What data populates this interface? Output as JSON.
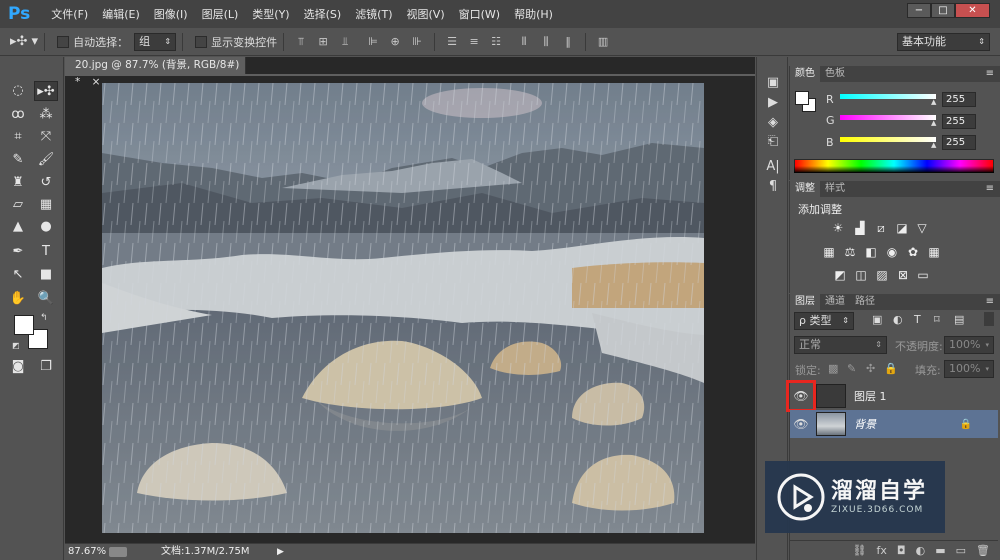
{
  "app": {
    "logo": "Ps"
  },
  "menu": [
    "文件(F)",
    "编辑(E)",
    "图像(I)",
    "图层(L)",
    "类型(Y)",
    "选择(S)",
    "滤镜(T)",
    "视图(V)",
    "窗口(W)",
    "帮助(H)"
  ],
  "window_controls": {
    "minimize": "−",
    "maximize": "□",
    "close": "✕"
  },
  "options": {
    "auto_select_label": "自动选择：",
    "auto_select_value": "组",
    "show_transform_label": "显示变换控件",
    "workspace": "基本功能"
  },
  "document": {
    "tab_title": "20.jpg @ 87.7% (背景, RGB/8#) *",
    "close_glyph": "×"
  },
  "status": {
    "zoom": "87.67%",
    "doc_size": "文档:1.37M/2.75M"
  },
  "color_panel": {
    "tabs": [
      "颜色",
      "色板"
    ],
    "channels": [
      {
        "label": "R",
        "value": "255"
      },
      {
        "label": "G",
        "value": "255"
      },
      {
        "label": "B",
        "value": "255"
      }
    ]
  },
  "adjust_panel": {
    "tabs": [
      "调整",
      "样式"
    ],
    "title": "添加调整"
  },
  "layers_panel": {
    "tabs": [
      "图层",
      "通道",
      "路径"
    ],
    "kind_filter": "ρ 类型",
    "blend_mode": "正常",
    "opacity_label": "不透明度:",
    "opacity_value": "100%",
    "lock_label": "锁定:",
    "fill_label": "填充:",
    "fill_value": "100%",
    "layers": [
      {
        "name": "图层 1",
        "visible": true,
        "selected": false,
        "locked": false
      },
      {
        "name": "背景",
        "visible": true,
        "selected": true,
        "locked": true
      }
    ]
  },
  "watermark": {
    "brand_cn": "溜溜自学",
    "url": "ZIXUE.3D66.COM"
  },
  "colors": {
    "ps_blue": "#31a8ff",
    "highlight_red": "#e8261f",
    "selected_layer": "#5d7394",
    "watermark_bg": "#26374e"
  }
}
